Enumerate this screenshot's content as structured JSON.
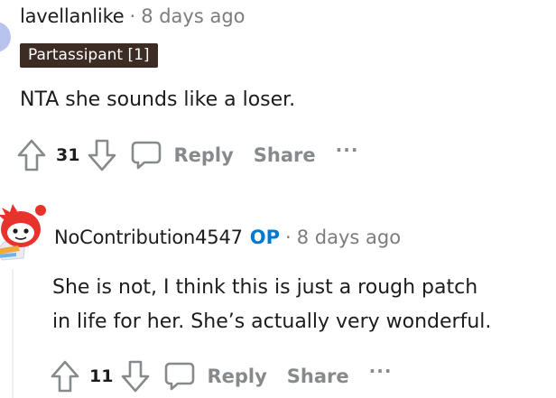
{
  "comment1": {
    "username": "lavellanlike",
    "separator": "·",
    "timestamp": "8 days ago",
    "flair": "Partassipant [1]",
    "body": "NTA she sounds like a loser.",
    "votes": "31",
    "reply_label": "Reply",
    "share_label": "Share",
    "more_label": "···"
  },
  "comment2": {
    "username": "NoContribution4547",
    "op_badge": "OP",
    "separator": "·",
    "timestamp": "8 days ago",
    "body_line1": "She is not, I think this is just a rough patch",
    "body_line2": "in life for her. She’s actually very wonderful.",
    "votes": "11",
    "reply_label": "Reply",
    "share_label": "Share",
    "more_label": "···"
  },
  "colors": {
    "flair_bg": "#3c2c24",
    "op_blue": "#0079d3",
    "meta_gray": "#7c7c7c",
    "action_gray": "#878a8c",
    "snoo_red": "#e8332c"
  }
}
